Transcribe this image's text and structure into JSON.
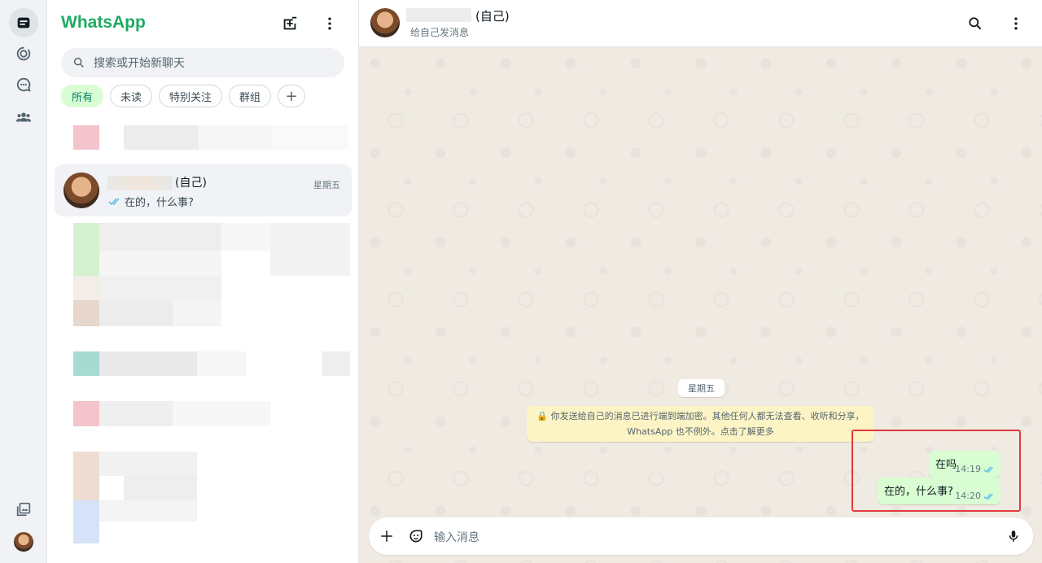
{
  "app": {
    "brand": "WhatsApp"
  },
  "rail": {
    "items": [
      "chats-icon",
      "status-icon",
      "channels-icon",
      "communities-icon"
    ],
    "bottom": [
      "media-icon",
      "profile-avatar"
    ]
  },
  "search": {
    "placeholder": "搜索或开始新聊天"
  },
  "filters": [
    "所有",
    "未读",
    "特别关注",
    "群组",
    "+"
  ],
  "chat_item": {
    "name_suffix": "(自己)",
    "time": "星期五",
    "last_message": "在的，什么事?"
  },
  "conversation": {
    "name_suffix": "(自己)",
    "subtitle": "给自己发消息",
    "day_label": "星期五",
    "e2e_line1": "你发送给自己的消息已进行端到端加密。其他任何人都无法查看、收听和分享，",
    "e2e_line2": "WhatsApp 也不例外。点击了解更多",
    "messages": [
      {
        "text": "在吗",
        "time": "14:19"
      },
      {
        "text": "在的，什么事?",
        "time": "14:20"
      }
    ],
    "composer_placeholder": "输入消息"
  },
  "colors": {
    "brand": "#1daa61",
    "bubble_out": "#d9fdd3",
    "wall": "#efeae2",
    "highlight": "#e0393e",
    "tick": "#53bdeb"
  }
}
